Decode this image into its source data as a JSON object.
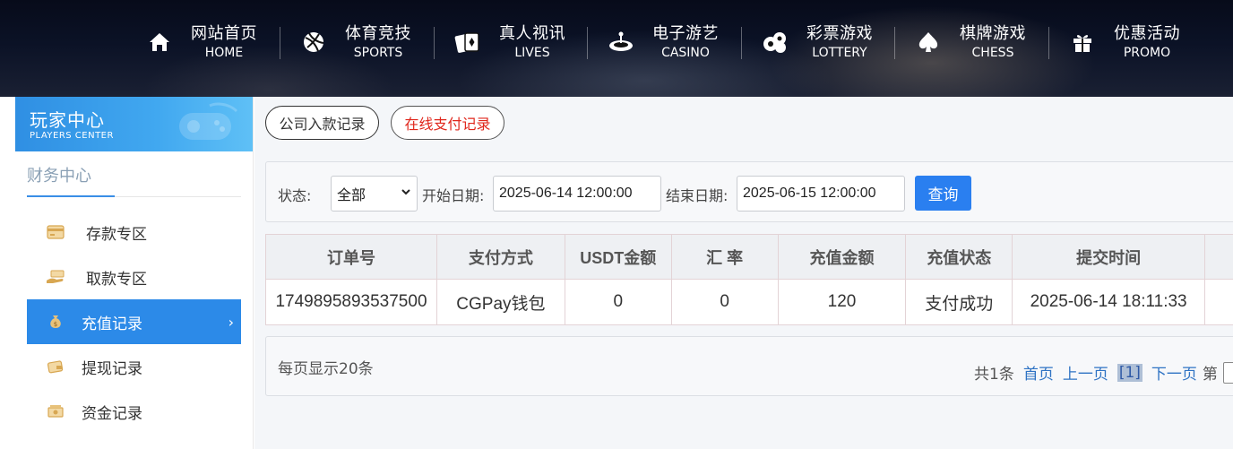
{
  "nav": [
    {
      "zh": "网站首页",
      "en": "HOME",
      "icon": "home-icon"
    },
    {
      "zh": "体育竞技",
      "en": "SPORTS",
      "icon": "ball-icon"
    },
    {
      "zh": "真人视讯",
      "en": "LIVES",
      "icon": "cards-icon"
    },
    {
      "zh": "电子游艺",
      "en": "CASINO",
      "icon": "roulette-icon"
    },
    {
      "zh": "彩票游戏",
      "en": "LOTTERY",
      "icon": "lottery-balls-icon"
    },
    {
      "zh": "棋牌游戏",
      "en": "CHESS",
      "icon": "spade-icon"
    },
    {
      "zh": "优惠活动",
      "en": "PROMO",
      "icon": "gift-icon"
    }
  ],
  "sidebar": {
    "title": "玩家中心",
    "subtitle": "PLAYERS CENTER",
    "section": "财务中心",
    "items": [
      {
        "label": "存款专区",
        "icon": "card-icon"
      },
      {
        "label": "取款专区",
        "icon": "withdraw-hand-icon"
      },
      {
        "label": "充值记录",
        "icon": "money-bag-icon",
        "active": true
      },
      {
        "label": "提现记录",
        "icon": "wallet-icon"
      },
      {
        "label": "资金记录",
        "icon": "cash-icon"
      }
    ]
  },
  "tabs": [
    {
      "label": "公司入款记录"
    },
    {
      "label": "在线支付记录",
      "active": true
    }
  ],
  "filter": {
    "status_label": "状态:",
    "status_value": "全部",
    "start_label": "开始日期:",
    "start_value": "2025-06-14 12:00:00",
    "end_label": "结束日期:",
    "end_value": "2025-06-15 12:00:00",
    "query_label": "查询"
  },
  "table": {
    "headers": [
      "订单号",
      "支付方式",
      "USDT金额",
      "汇 率",
      "充值金额",
      "充值状态",
      "提交时间",
      ""
    ],
    "rows": [
      [
        "1749895893537500",
        "CGPay钱包",
        "0",
        "0",
        "120",
        "支付成功",
        "2025-06-14 18:11:33",
        ""
      ]
    ]
  },
  "pager": {
    "per_page": "每页显示20条",
    "total": "共1条",
    "first": "首页",
    "prev": "上一页",
    "current": "[1]",
    "next": "下一页",
    "page_prefix": "第"
  },
  "colors": {
    "accent": "#2c8ae8",
    "active_tab_text": "#e0261b",
    "query_button": "#2a7ff0"
  }
}
